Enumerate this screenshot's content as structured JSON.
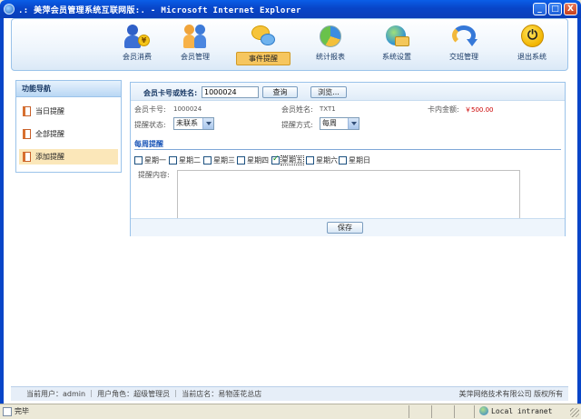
{
  "window": {
    "title": ".: 美萍会员管理系统互联网版:. - Microsoft Internet Explorer",
    "minimize": "_",
    "maximize": "□",
    "close": "X"
  },
  "nav": {
    "items": [
      {
        "label": "会员消费",
        "icon": "member-consume-icon"
      },
      {
        "label": "会员管理",
        "icon": "member-manage-icon"
      },
      {
        "label": "事件提醒",
        "icon": "event-remind-icon",
        "active": true
      },
      {
        "label": "统计报表",
        "icon": "pie-chart-icon"
      },
      {
        "label": "系统设置",
        "icon": "system-settings-icon"
      },
      {
        "label": "交班管理",
        "icon": "shift-handover-icon"
      },
      {
        "label": "退出系统",
        "icon": "power-icon"
      }
    ],
    "active_color": "#f6c65f"
  },
  "sidebar": {
    "title": "功能导航",
    "items": [
      {
        "label": "当日提醒"
      },
      {
        "label": "全部提醒"
      },
      {
        "label": "添加提醒",
        "active": true
      }
    ]
  },
  "search": {
    "label": "会员卡号或姓名:",
    "value": "1000024",
    "query_button": "查询",
    "browse_button": "浏览..."
  },
  "member": {
    "card_label": "会员卡号:",
    "card_value": "1000024",
    "name_label": "会员姓名:",
    "name_value": "TXT1",
    "balance_label": "卡内金额:",
    "balance_value": "￥500.00",
    "balance_color": "#cc0000"
  },
  "reminder": {
    "status_label": "提醒状态:",
    "status_value": "未联系",
    "method_label": "提醒方式:",
    "method_value": "每周",
    "section_title": "每周提醒",
    "weekdays": [
      {
        "label": "星期一",
        "checked": false
      },
      {
        "label": "星期二",
        "checked": false
      },
      {
        "label": "星期三",
        "checked": false
      },
      {
        "label": "星期四",
        "checked": false
      },
      {
        "label": "星期五",
        "checked": true
      },
      {
        "label": "星期六",
        "checked": false
      },
      {
        "label": "星期日",
        "checked": false
      }
    ],
    "content_label": "提醒内容:",
    "content_value": "",
    "save_button": "保存"
  },
  "footer": {
    "left": "当前用户：admin  ｜ 用户角色：超级管理员  ｜ 当前店名：易物莲花总店",
    "right": "美萍网络技术有限公司 版权所有"
  },
  "statusbar": {
    "status": "完毕",
    "zone": "Local intranet"
  }
}
